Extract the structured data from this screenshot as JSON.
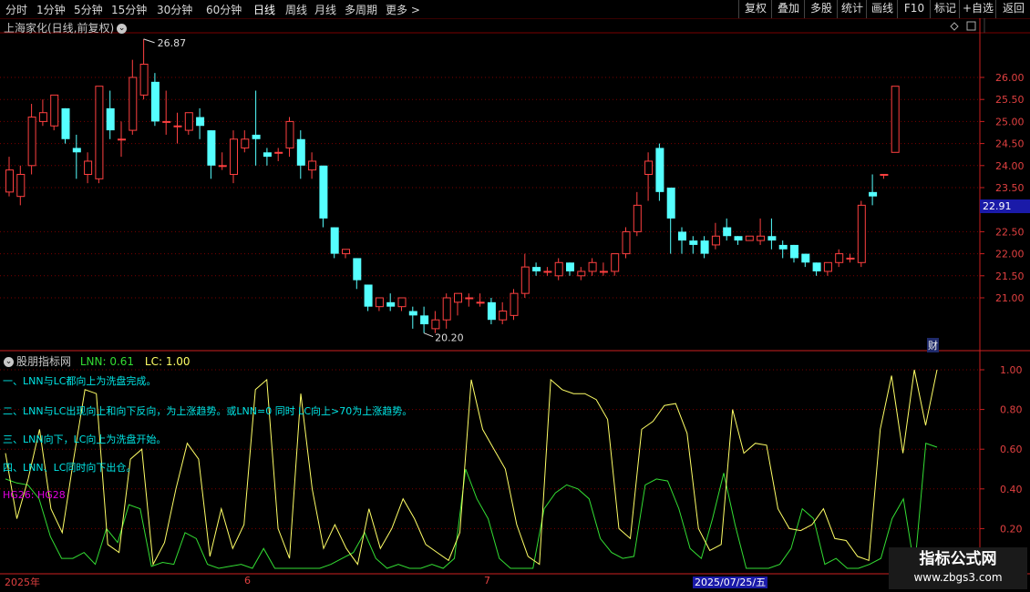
{
  "toolbar": {
    "periods": [
      "分时",
      "1分钟",
      "5分钟",
      "15分钟",
      "30分钟",
      "60分钟",
      "日线",
      "周线",
      "月线",
      "多周期",
      "更多 >"
    ],
    "active_period": "日线",
    "buttons": [
      "复权",
      "叠加",
      "多股",
      "统计",
      "画线",
      "F10",
      "标记",
      "+自选",
      "返回"
    ]
  },
  "main_chart": {
    "title": "上海家化(日线,前复权)",
    "high_label": "26.87",
    "low_label": "20.20",
    "price_axis": [
      "26.00",
      "25.50",
      "25.00",
      "24.50",
      "24.00",
      "23.50",
      "22.91",
      "22.50",
      "22.00",
      "21.50",
      "21.00"
    ],
    "current_price": "22.91",
    "fin_badge": "财"
  },
  "indicator": {
    "name": "股朋指标网",
    "lnn_label": "LNN: 0.61",
    "lc_label": "LC: 1.00",
    "notes": [
      "一、LNN与LC都向上为洗盘完成。",
      "二、LNN与LC出现向上和向下反向，为上涨趋势。或LNN=0 同时 LC向上>70为上涨趋势。",
      "三、LNN向下，LC向上为洗盘开始。",
      "四、LNN、LC同时向下出仓。"
    ],
    "hg_label": "HG26: HG28",
    "axis": [
      "1.00",
      "0.80",
      "0.60",
      "0.40",
      "0.20"
    ]
  },
  "date_axis": {
    "labels": [
      "2025年",
      "6",
      "7",
      "2025/07/25/五"
    ]
  },
  "watermark": {
    "title": "指标公式网",
    "url": "www.zbgs3.com"
  },
  "colors": {
    "up": "#ff4040",
    "down": "#55ffff",
    "lnn_line": "#ffff66",
    "lc_line": "#33dd33",
    "grid": "#7a0000",
    "price_tag": "#1a1aa8"
  },
  "chart_data": {
    "type": "candlestick",
    "ylim": [
      20.0,
      27.0
    ],
    "candles": [
      [
        23.4,
        23.9,
        23.3,
        24.2
      ],
      [
        23.3,
        23.8,
        23.1,
        24.0
      ],
      [
        24.0,
        25.1,
        23.8,
        25.4
      ],
      [
        25.0,
        25.2,
        24.9,
        25.5
      ],
      [
        24.9,
        25.6,
        24.8,
        25.6
      ],
      [
        25.3,
        24.6,
        24.5,
        25.3
      ],
      [
        24.4,
        24.3,
        23.7,
        24.7
      ],
      [
        23.8,
        24.1,
        23.6,
        24.3
      ],
      [
        23.7,
        25.8,
        23.6,
        25.8
      ],
      [
        25.3,
        24.8,
        24.6,
        25.7
      ],
      [
        24.6,
        24.6,
        24.2,
        25.0
      ],
      [
        24.8,
        26.0,
        24.7,
        26.4
      ],
      [
        25.6,
        26.3,
        25.5,
        26.87
      ],
      [
        25.9,
        25.0,
        24.9,
        26.1
      ],
      [
        25.0,
        25.0,
        24.7,
        25.7
      ],
      [
        24.9,
        24.9,
        24.5,
        25.2
      ],
      [
        24.8,
        25.2,
        24.7,
        25.2
      ],
      [
        25.1,
        24.9,
        24.6,
        25.3
      ],
      [
        24.8,
        24.0,
        23.7,
        24.8
      ],
      [
        24.0,
        24.0,
        23.9,
        24.3
      ],
      [
        23.8,
        24.6,
        23.6,
        24.8
      ],
      [
        24.4,
        24.6,
        24.3,
        24.8
      ],
      [
        24.7,
        24.6,
        24.0,
        25.7
      ],
      [
        24.3,
        24.2,
        24.0,
        24.4
      ],
      [
        24.3,
        24.3,
        24.1,
        24.4
      ],
      [
        24.4,
        25.0,
        24.2,
        25.1
      ],
      [
        24.6,
        24.0,
        23.7,
        24.8
      ],
      [
        23.9,
        24.1,
        23.7,
        24.3
      ],
      [
        24.0,
        22.8,
        22.6,
        24.0
      ],
      [
        22.6,
        22.0,
        21.9,
        22.6
      ],
      [
        22.0,
        22.1,
        21.9,
        22.1
      ],
      [
        21.9,
        21.4,
        21.2,
        21.9
      ],
      [
        21.3,
        20.8,
        20.7,
        21.3
      ],
      [
        20.8,
        21.0,
        20.7,
        21.0
      ],
      [
        20.9,
        20.8,
        20.7,
        21.1
      ],
      [
        20.8,
        21.0,
        20.7,
        21.0
      ],
      [
        20.7,
        20.6,
        20.3,
        20.8
      ],
      [
        20.6,
        20.4,
        20.2,
        20.8
      ],
      [
        20.3,
        20.5,
        20.2,
        20.7
      ],
      [
        20.5,
        21.0,
        20.3,
        21.1
      ],
      [
        20.9,
        21.1,
        20.6,
        21.1
      ],
      [
        21.0,
        21.0,
        20.8,
        21.1
      ],
      [
        20.9,
        20.9,
        20.8,
        21.1
      ],
      [
        20.9,
        20.5,
        20.4,
        21.0
      ],
      [
        20.5,
        20.7,
        20.4,
        20.9
      ],
      [
        20.6,
        21.1,
        20.5,
        21.2
      ],
      [
        21.1,
        21.7,
        21.0,
        22.0
      ],
      [
        21.7,
        21.6,
        21.5,
        21.8
      ],
      [
        21.6,
        21.6,
        21.5,
        21.7
      ],
      [
        21.5,
        21.8,
        21.4,
        21.9
      ],
      [
        21.8,
        21.6,
        21.5,
        21.8
      ],
      [
        21.5,
        21.6,
        21.4,
        21.7
      ],
      [
        21.6,
        21.8,
        21.5,
        21.9
      ],
      [
        21.6,
        21.6,
        21.5,
        21.8
      ],
      [
        21.6,
        22.0,
        21.5,
        22.0
      ],
      [
        22.0,
        22.5,
        21.9,
        22.6
      ],
      [
        22.5,
        23.1,
        22.4,
        23.4
      ],
      [
        23.8,
        24.1,
        23.2,
        24.3
      ],
      [
        24.4,
        23.4,
        23.2,
        24.5
      ],
      [
        23.5,
        22.8,
        22.0,
        23.5
      ],
      [
        22.5,
        22.3,
        22.0,
        22.6
      ],
      [
        22.3,
        22.2,
        22.0,
        22.4
      ],
      [
        22.3,
        22.0,
        21.9,
        22.4
      ],
      [
        22.2,
        22.4,
        22.1,
        22.7
      ],
      [
        22.6,
        22.4,
        22.3,
        22.8
      ],
      [
        22.4,
        22.3,
        22.2,
        22.4
      ],
      [
        22.3,
        22.4,
        22.3,
        22.4
      ],
      [
        22.3,
        22.4,
        22.2,
        22.8
      ],
      [
        22.4,
        22.3,
        22.1,
        22.8
      ],
      [
        22.2,
        22.1,
        21.9,
        22.3
      ],
      [
        22.2,
        21.9,
        21.8,
        22.2
      ],
      [
        22.0,
        21.8,
        21.7,
        22.0
      ],
      [
        21.8,
        21.6,
        21.5,
        21.8
      ],
      [
        21.6,
        21.8,
        21.5,
        21.8
      ],
      [
        21.8,
        22.0,
        21.7,
        22.1
      ],
      [
        21.9,
        21.9,
        21.8,
        22.0
      ],
      [
        21.8,
        23.1,
        21.7,
        23.2
      ],
      [
        23.4,
        23.3,
        23.1,
        23.8
      ],
      [
        23.8,
        23.8,
        23.7,
        23.8
      ],
      [
        24.3,
        25.8,
        24.3,
        25.8
      ]
    ],
    "lnn": [
      0.58,
      0.25,
      0.45,
      0.7,
      0.3,
      0.18,
      0.55,
      0.9,
      0.88,
      0.12,
      0.08,
      0.55,
      0.6,
      0.02,
      0.13,
      0.4,
      0.63,
      0.55,
      0.06,
      0.3,
      0.1,
      0.22,
      0.9,
      0.95,
      0.2,
      0.05,
      0.88,
      0.4,
      0.1,
      0.22,
      0.1,
      0.02,
      0.3,
      0.1,
      0.2,
      0.35,
      0.25,
      0.12,
      0.08,
      0.04,
      0.18,
      0.95,
      0.7,
      0.6,
      0.5,
      0.22,
      0.06,
      0.02,
      0.95,
      0.9,
      0.88,
      0.88,
      0.85,
      0.75,
      0.2,
      0.15,
      0.7,
      0.74,
      0.82,
      0.83,
      0.68,
      0.2,
      0.09,
      0.12,
      0.8,
      0.58,
      0.63,
      0.62,
      0.3,
      0.2,
      0.19,
      0.22,
      0.3,
      0.15,
      0.14,
      0.06,
      0.04,
      0.7,
      0.97,
      0.58,
      1.0,
      0.72,
      1.0
    ],
    "lc": [
      0.45,
      0.43,
      0.42,
      0.35,
      0.16,
      0.05,
      0.05,
      0.08,
      0.02,
      0.2,
      0.13,
      0.32,
      0.3,
      0.01,
      0.03,
      0.02,
      0.18,
      0.15,
      0.02,
      0.0,
      0.01,
      0.02,
      0.0,
      0.1,
      0.0,
      0.0,
      0.0,
      0.0,
      0.0,
      0.02,
      0.05,
      0.08,
      0.18,
      0.05,
      0.0,
      0.02,
      0.0,
      0.0,
      0.02,
      0.0,
      0.05,
      0.5,
      0.35,
      0.25,
      0.05,
      0.0,
      0.0,
      0.0,
      0.3,
      0.38,
      0.42,
      0.4,
      0.35,
      0.15,
      0.08,
      0.05,
      0.06,
      0.42,
      0.45,
      0.44,
      0.3,
      0.1,
      0.05,
      0.25,
      0.48,
      0.22,
      0.0,
      0.0,
      0.0,
      0.02,
      0.1,
      0.3,
      0.25,
      0.02,
      0.05,
      0.0,
      0.0,
      0.02,
      0.05,
      0.25,
      0.35,
      0.0,
      0.63,
      0.61
    ]
  }
}
